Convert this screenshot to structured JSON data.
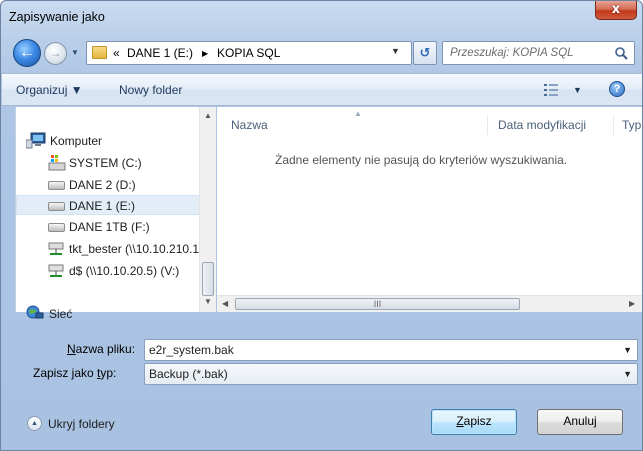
{
  "window": {
    "title": "Zapisywanie jako",
    "close_glyph": "x"
  },
  "address": {
    "overflow_marker": "«",
    "segments": [
      "DANE 1 (E:)",
      "KOPIA SQL"
    ],
    "separator": "▶"
  },
  "search": {
    "placeholder": "Przeszukaj: KOPIA SQL"
  },
  "toolbar": {
    "organize_label": "Organizuj ▼",
    "new_folder_label": "Nowy folder"
  },
  "nav": {
    "items": [
      {
        "label": "Komputer",
        "icon": "computer-icon"
      },
      {
        "label": "SYSTEM (C:)",
        "icon": "system-drive-icon"
      },
      {
        "label": "DANE 2 (D:)",
        "icon": "drive-icon"
      },
      {
        "label": "DANE 1 (E:)",
        "icon": "drive-icon",
        "selected": true
      },
      {
        "label": "DANE 1TB (F:)",
        "icon": "drive-icon"
      },
      {
        "label": "tkt_bester (\\\\10.10.210.1",
        "icon": "network-drive-icon"
      },
      {
        "label": "d$ (\\\\10.10.20.5) (V:)",
        "icon": "network-drive-icon"
      },
      {
        "label": "Sieć",
        "icon": "network-icon"
      }
    ]
  },
  "file_list": {
    "columns": [
      "Nazwa",
      "Data modyfikacji",
      "Typ"
    ],
    "empty_message": "Żadne elementy nie pasują do kryteriów wyszukiwania.",
    "hscroll_grip": "III"
  },
  "form": {
    "filename_label_underlined": "N",
    "filename_label_rest": "azwa pliku:",
    "filename_value": "e2r_system.bak",
    "filetype_label_prefix": "Zapisz jako ",
    "filetype_label_underlined": "t",
    "filetype_label_rest": "yp:",
    "filetype_value": "Backup (*.bak)"
  },
  "footer": {
    "hide_folders_label": "Ukryj foldery",
    "save_underlined": "Z",
    "save_rest": "apisz",
    "cancel_label": "Anuluj"
  },
  "colors": {
    "accent": "#3c7fb1",
    "title_bar": "#c9dbef",
    "close_button": "#c2391c"
  }
}
